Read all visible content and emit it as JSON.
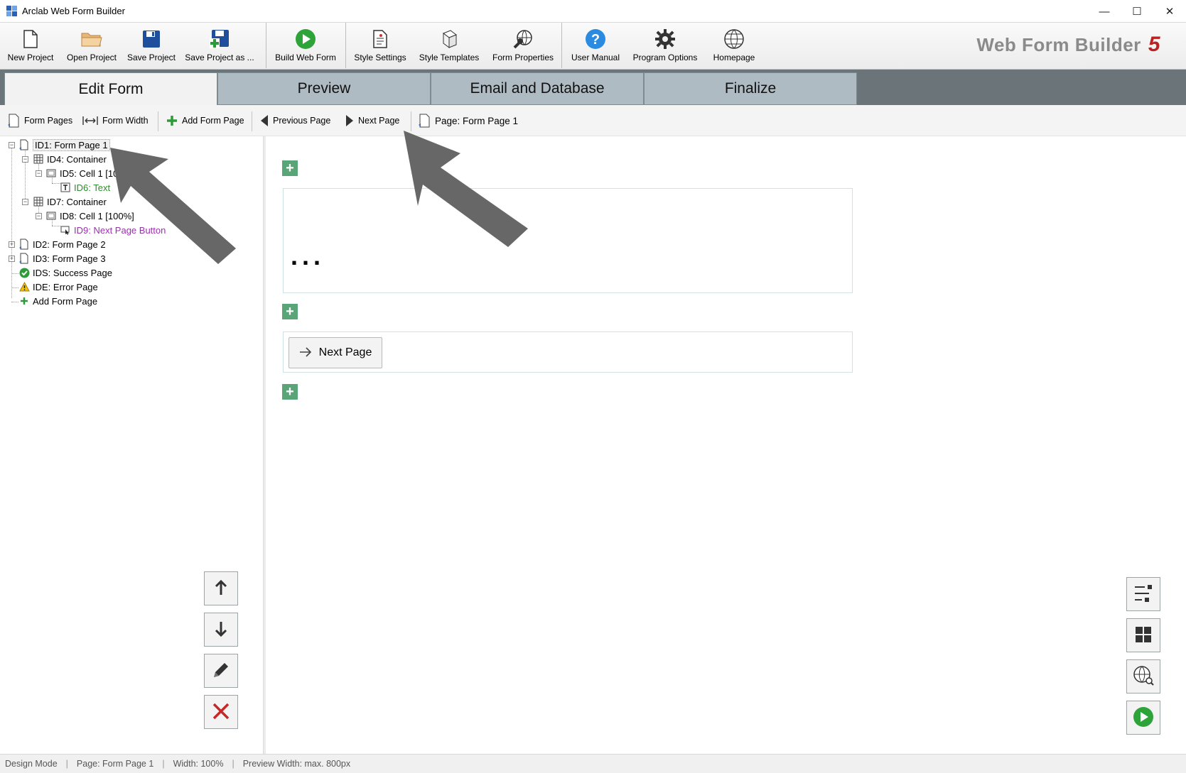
{
  "window": {
    "title": "Arclab Web Form Builder",
    "controls": [
      "—",
      "☐",
      "✕"
    ]
  },
  "toolbar": {
    "new_project": "New Project",
    "open_project": "Open Project",
    "save_project": "Save Project",
    "save_project_as": "Save Project as ...",
    "build_web_form": "Build Web Form",
    "style_settings": "Style Settings",
    "style_templates": "Style Templates",
    "form_properties": "Form Properties",
    "user_manual": "User Manual",
    "program_options": "Program Options",
    "homepage": "Homepage",
    "brand": "Web Form Builder",
    "brand_version": "5"
  },
  "tabs": {
    "edit_form": "Edit Form",
    "preview": "Preview",
    "email_database": "Email and Database",
    "finalize": "Finalize"
  },
  "subtoolbar": {
    "form_pages": "Form Pages",
    "form_width": "Form Width",
    "add_form_page": "Add Form Page",
    "previous_page": "Previous Page",
    "next_page": "Next Page",
    "current_page": "Page: Form Page 1"
  },
  "tree": {
    "p1": "ID1: Form Page 1",
    "c4": "ID4: Container",
    "cell5": "ID5: Cell 1 [100%]",
    "text6": "ID6: Text",
    "c7": "ID7: Container",
    "cell8": "ID8: Cell 1 [100%]",
    "btn9": "ID9: Next Page Button",
    "p2": "ID2: Form Page 2",
    "p3": "ID3: Form Page 3",
    "success": "IDS: Success Page",
    "error": "IDE: Error Page",
    "add": "Add Form Page"
  },
  "canvas": {
    "text_placeholder": "...",
    "next_page_button": "Next Page"
  },
  "colors": {
    "tab_active": "#f2f2f2",
    "tab_inactive": "#aebbc3",
    "tabbar_bg": "#6b7478",
    "plus_green": "#5aa577",
    "text_item_green": "#2e8b2e",
    "button_item_purple": "#9b2fb0",
    "arrow_gray": "#666666"
  },
  "statusbar": {
    "mode": "Design Mode",
    "page": "Page: Form Page 1",
    "width": "Width: 100%",
    "preview_width": "Preview Width: max. 800px"
  }
}
